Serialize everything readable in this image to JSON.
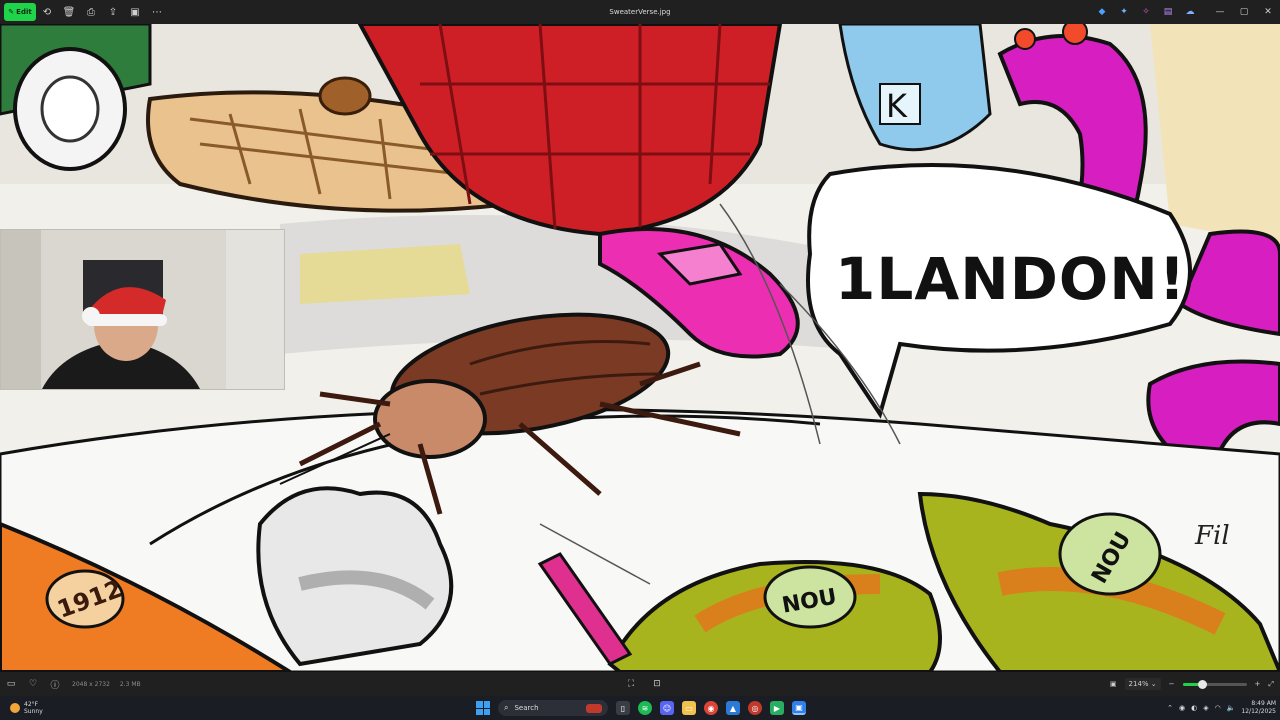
{
  "titlebar": {
    "edit_label": "Edit",
    "filename": "SweaterVerse.jpg",
    "left_icons": [
      "rotate-icon",
      "delete-icon",
      "print-icon",
      "share-icon",
      "slideshow-icon",
      "more-icon"
    ],
    "right_icons": [
      "app-icon-1",
      "app-icon-2",
      "app-icon-3",
      "app-icon-4",
      "app-icon-5"
    ]
  },
  "image": {
    "speech_bubble_text": "1LANDON!",
    "bottle_label_left": "NOU",
    "bottle_label_right": "NOU",
    "sign_text": "1912",
    "signature": "Fil"
  },
  "statusbar": {
    "dimensions": "2048 x 2732",
    "filesize": "2.3 MB",
    "zoom": "214%",
    "zoom_fraction": 0.3
  },
  "taskbar": {
    "temperature": "42°F",
    "condition": "Sunny",
    "search_placeholder": "Search",
    "time": "8:49 AM",
    "date": "12/12/2025"
  },
  "colors": {
    "accent": "#1fd34a",
    "titlebar_bg": "#202020",
    "taskbar_bg": "#1b1d24"
  }
}
